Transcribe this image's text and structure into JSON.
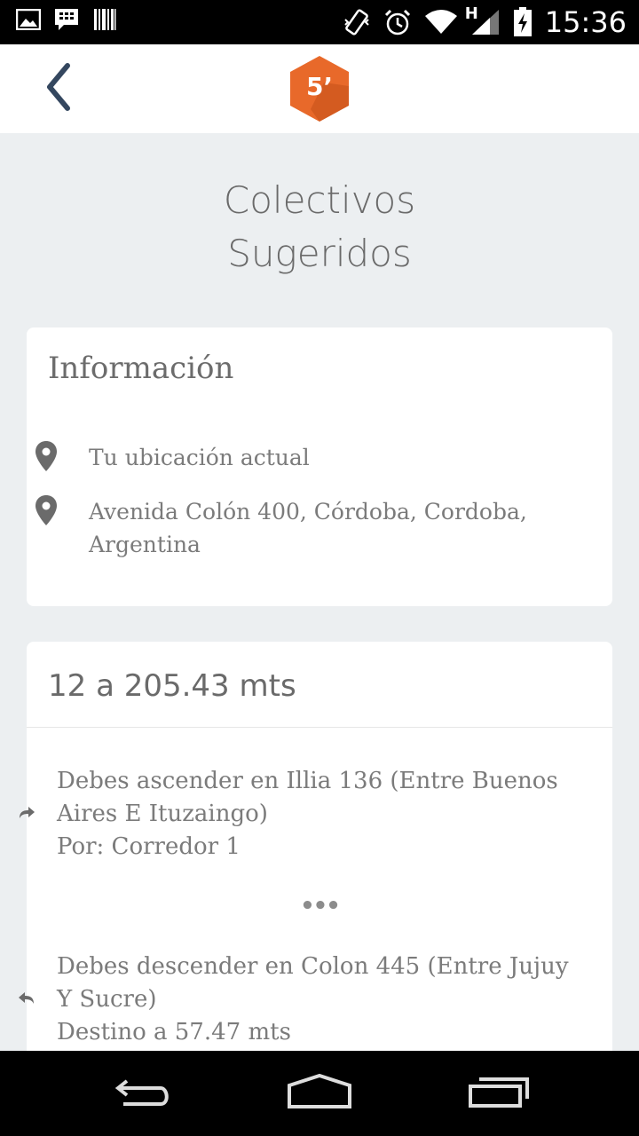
{
  "status_bar": {
    "time": "15:36",
    "network_type": "H",
    "icons": [
      "image-icon",
      "bbm-icon",
      "barcode-icon",
      "vibrate-icon",
      "alarm-icon",
      "wifi-icon",
      "signal-icon",
      "battery-charging-icon"
    ]
  },
  "app_bar": {
    "back_icon": "chevron-left-icon",
    "logo_text": "5’",
    "logo_color": "#e8692a"
  },
  "page": {
    "title_line1": "Colectivos",
    "title_line2": "Sugeridos"
  },
  "info_card": {
    "title": "Información",
    "locations": [
      {
        "icon": "location-pin-icon",
        "text": "Tu ubicación actual"
      },
      {
        "icon": "location-pin-icon",
        "text": "Avenida Colón 400, Córdoba, Cordoba, Argentina"
      }
    ]
  },
  "route_card": {
    "title": "12 a 205.43 mts",
    "steps": [
      {
        "icon": "turn-right-arrow-icon",
        "line1": "Debes ascender en Illia 136 (Entre Buenos Aires E Ituzaingo)",
        "line2": "Por: Corredor 1"
      },
      {
        "icon": "turn-left-arrow-icon",
        "line1": "Debes descender en Colon 445 (Entre Jujuy Y Sucre)",
        "line2": "Destino a 57.47 mts"
      }
    ],
    "ellipsis": "•••"
  },
  "nav_bar": {
    "buttons": [
      "back-nav-icon",
      "home-nav-icon",
      "recent-apps-icon"
    ]
  }
}
